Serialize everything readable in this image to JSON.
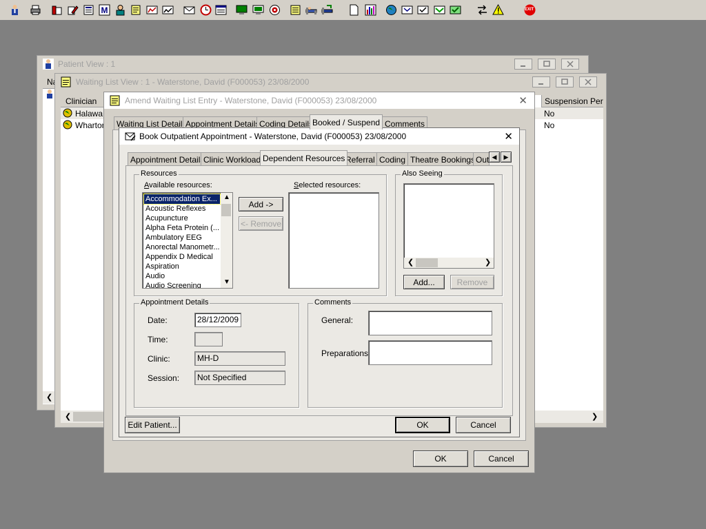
{
  "toolbar": {
    "icons": [
      "patient-icon",
      "print-icon",
      "books-icon",
      "books-edit-icon",
      "document-list-icon",
      "letter-m-icon",
      "person-icon",
      "notepad-icon",
      "chart-icon",
      "chart-edit-icon",
      "envelope-icon",
      "clock-icon",
      "window-icon",
      "monitor-icon",
      "monitor-edit-icon",
      "target-icon",
      "note-icon",
      "bed-icon",
      "bed-transfer-icon",
      "blank-page-icon",
      "bar-chart-icon",
      "globe-icon",
      "inbox-icon",
      "inbox-check-icon",
      "inbox-green-icon",
      "inbox-green-check-icon",
      "swap-arrows-icon",
      "warning-icon",
      "exit-icon"
    ],
    "exit_label": "EXIT"
  },
  "patient_view": {
    "title": "Patient View : 1",
    "col_first": "Na"
  },
  "waiting_list_view": {
    "title": "Waiting List View :  1 - Waterstone, David (F000053) 23/08/2000",
    "col_clinician": "Clinician",
    "col_suspension": "Suspension Per...",
    "rows": [
      {
        "clinician": "Halawa,",
        "suspension": "No"
      },
      {
        "clinician": "Wharton",
        "suspension": "No"
      }
    ]
  },
  "amend_dialog": {
    "title": "Amend Waiting List Entry - Waterstone, David (F000053) 23/08/2000",
    "tabs": [
      "Waiting List Details",
      "Appointment Details",
      "Coding Details",
      "Booked / Suspend",
      "Comments"
    ],
    "ok": "OK",
    "cancel": "Cancel"
  },
  "book_dialog": {
    "title": "Book Outpatient Appointment - Waterstone, David (F000053) 23/08/2000",
    "tabs": [
      "Appointment Details",
      "Clinic Workload",
      "Dependent Resources",
      "Referral",
      "Coding",
      "Theatre Bookings",
      "Out"
    ],
    "resources": {
      "caption": "Resources",
      "available_label": "Available resources:",
      "available_items": [
        "Accommodation Ex...",
        "Acoustic Reflexes",
        "Acupuncture",
        "Alpha Feta Protein (...",
        "Ambulatory EEG",
        "Anorectal Manometr...",
        "Appendix D Medical",
        "Aspiration",
        "Audio",
        "Audio Screening"
      ],
      "selected_label": "Selected resources:",
      "add": "Add ->",
      "remove": "<- Remove"
    },
    "also_seeing": {
      "caption": "Also Seeing",
      "add": "Add...",
      "remove": "Remove"
    },
    "appointment_details": {
      "caption": "Appointment Details",
      "date_label": "Date:",
      "date_value": "28/12/2009",
      "time_label": "Time:",
      "time_value": "",
      "clinic_label": "Clinic:",
      "clinic_value": "MH-D",
      "session_label": "Session:",
      "session_value": "Not Specified"
    },
    "comments": {
      "caption": "Comments",
      "general_label": "General:",
      "general_value": "",
      "preparations_label": "Preparations:",
      "preparations_value": ""
    },
    "edit_patient": "Edit Patient...",
    "ok": "OK",
    "cancel": "Cancel"
  },
  "colors": {
    "selection": "#0a246a",
    "face": "#d4d0c8",
    "desktop": "#808080"
  }
}
